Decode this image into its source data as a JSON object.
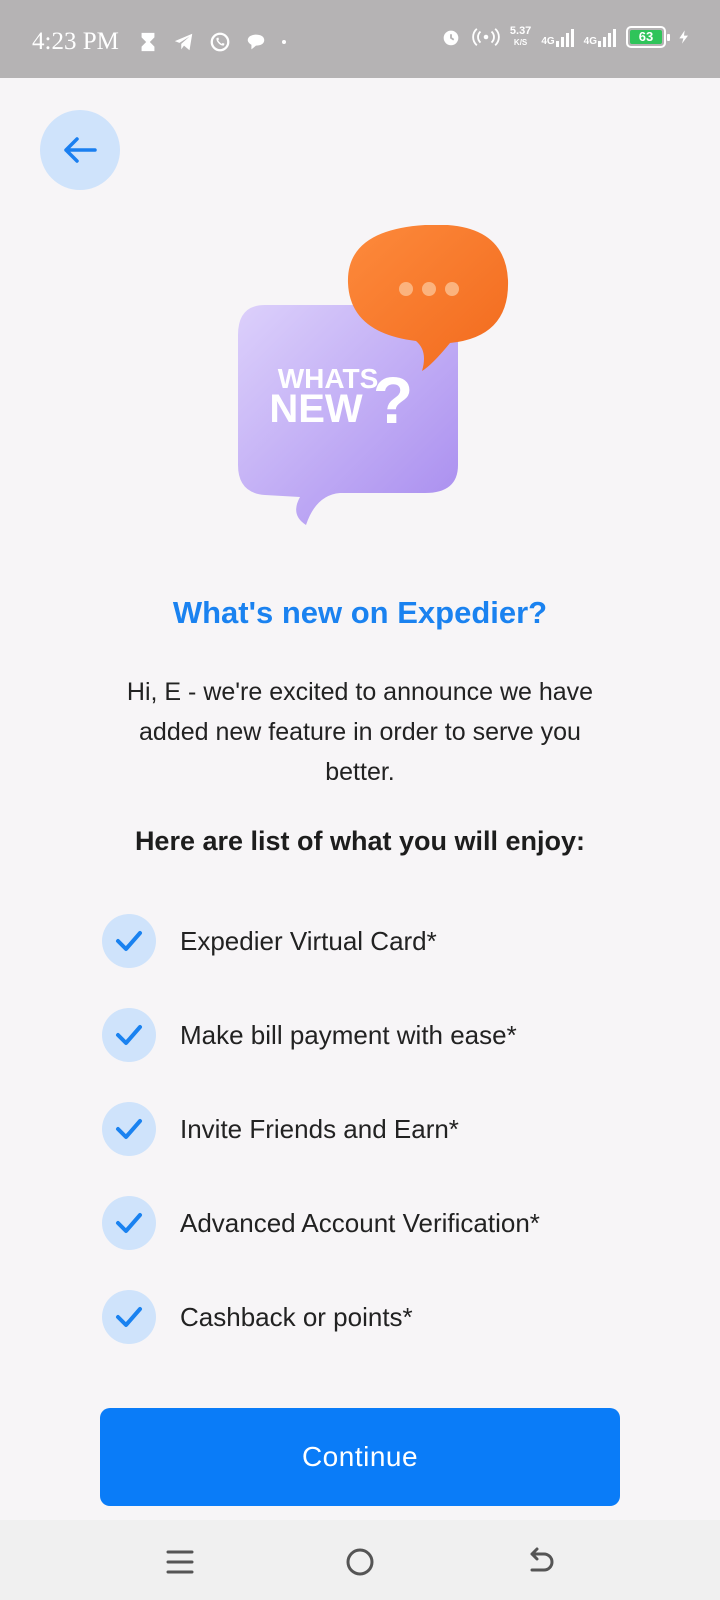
{
  "status_bar": {
    "time": "4:23 PM",
    "net_speed": "5.37",
    "net_unit": "K/S",
    "signal_1": "4G",
    "signal_2": "4G",
    "battery_level": "63"
  },
  "back_button": {
    "icon": "arrow-left-icon"
  },
  "illustration": {
    "badge_line1": "WHATS",
    "badge_line2": "NEW",
    "badge_symbol": "?"
  },
  "title": "What's new on Expedier?",
  "intro": "Hi, E - we're excited to announce we have added new feature in order to serve you better.",
  "list_heading": "Here are list of what you will enjoy:",
  "features": [
    {
      "label": "Expedier Virtual Card*"
    },
    {
      "label": "Make bill payment with ease*"
    },
    {
      "label": "Invite Friends and Earn*"
    },
    {
      "label": "Advanced Account Verification*"
    },
    {
      "label": "Cashback or points*"
    }
  ],
  "continue_label": "Continue",
  "colors": {
    "accent": "#0a7cf8",
    "title": "#1a82f0",
    "check_bg": "#cfe3fb",
    "bubble_purple": "#c7b2f5",
    "bubble_orange": "#fa7a2c"
  },
  "nav": {
    "menu_icon": "menu-icon",
    "home_icon": "home-circle-icon",
    "back_icon": "back-arrow-icon"
  }
}
